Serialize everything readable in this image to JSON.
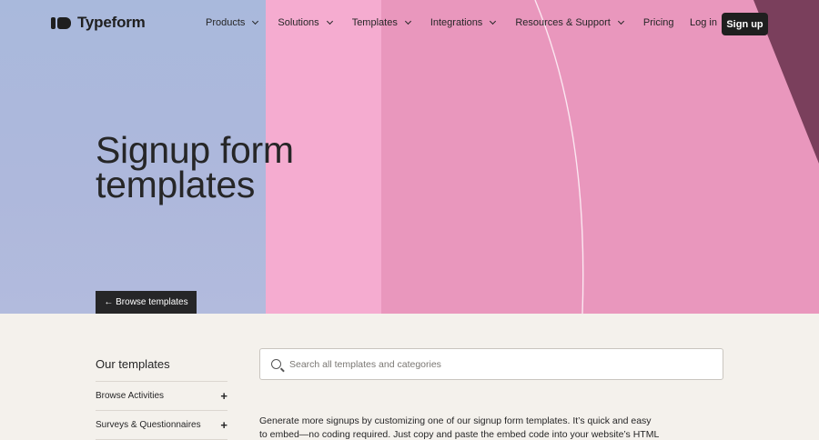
{
  "nav": {
    "logo_text": "Typeform",
    "items": [
      {
        "label": "Products",
        "has_dropdown": true
      },
      {
        "label": "Solutions",
        "has_dropdown": true
      },
      {
        "label": "Templates",
        "has_dropdown": true
      },
      {
        "label": "Integrations",
        "has_dropdown": true
      },
      {
        "label": "Resources & Support",
        "has_dropdown": true
      },
      {
        "label": "Pricing",
        "has_dropdown": false
      }
    ],
    "login_label": "Log in",
    "signup_label": "Sign up"
  },
  "hero": {
    "title_line1": "Signup form",
    "title_line2": "templates",
    "browse_button": "← Browse templates",
    "colors": {
      "blue": "#a9b9dc",
      "pink_light": "#f5acd0",
      "pink_mid": "#e997bd",
      "plum": "#7a3f5c"
    }
  },
  "sidebar": {
    "heading": "Our templates",
    "categories": [
      {
        "label": "Browse Activities",
        "icon": "plus-icon"
      },
      {
        "label": "Surveys & Questionnaires",
        "icon": "plus-icon"
      }
    ]
  },
  "search": {
    "placeholder": "Search all templates and categories",
    "value": ""
  },
  "description": "Generate more signups by customizing one of our signup form templates. It’s quick and easy to embed—no coding required. Just copy and paste the embed code into your website’s HTML and, voilà, your"
}
